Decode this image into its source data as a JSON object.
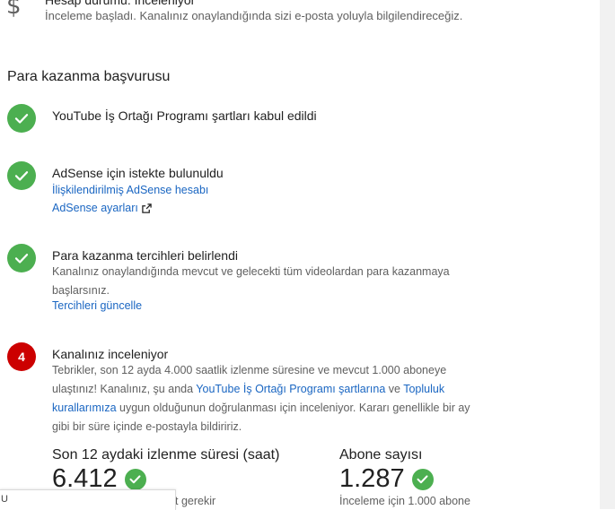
{
  "status": {
    "icon": "dollar-icon",
    "title": "Hesap durumu: İnceleniyor",
    "description": "İnceleme başladı. Kanalınız onaylandığında sizi e-posta yoluyla bilgilendireceğiz."
  },
  "section_title": "Para kazanma başvurusu",
  "steps": [
    {
      "state": "done",
      "title": "YouTube İş Ortağı Programı şartları kabul edildi"
    },
    {
      "state": "done",
      "title": "AdSense için istekte bulunuldu",
      "links": [
        "İlişkilendirilmiş AdSense hesabı",
        "AdSense ayarları"
      ]
    },
    {
      "state": "done",
      "title": "Para kazanma tercihleri belirlendi",
      "text_line1": "Kanalınız onaylandığında mevcut ve gelecekti tüm videolardan para kazanmaya",
      "text_line2": "başlarsınız.",
      "link": "Tercihleri güncelle"
    },
    {
      "state": "current",
      "number": "4",
      "title": "Kanalınız inceleniyor",
      "text_part1": "Tebrikler, son 12 ayda 4.000 saatlik izlenme süresine ve mevcut 1.000 aboneye ulaştınız! Kanalınız, şu anda ",
      "link1": "YouTube İş Ortağı Programı şartlarına",
      "text_part2": " ve ",
      "link2": "Topluluk kurallarımıza",
      "text_part3": " uygun olduğunun doğrulanması için inceleniyor. Kararı genellikle bir ay gibi bir süre içinde e-postayla bildiririz."
    }
  ],
  "stats": [
    {
      "label": "Son 12 aydaki izlenme süresi (saat)",
      "value": "6.412",
      "note": "t gerekir"
    },
    {
      "label": "Abone sayısı",
      "value": "1.287",
      "note": "İnceleme için 1.000 abone"
    }
  ],
  "overlay": {
    "text": "U"
  },
  "colors": {
    "success": "#4caf50",
    "alert": "#cc0000",
    "link": "#1a66c2"
  }
}
